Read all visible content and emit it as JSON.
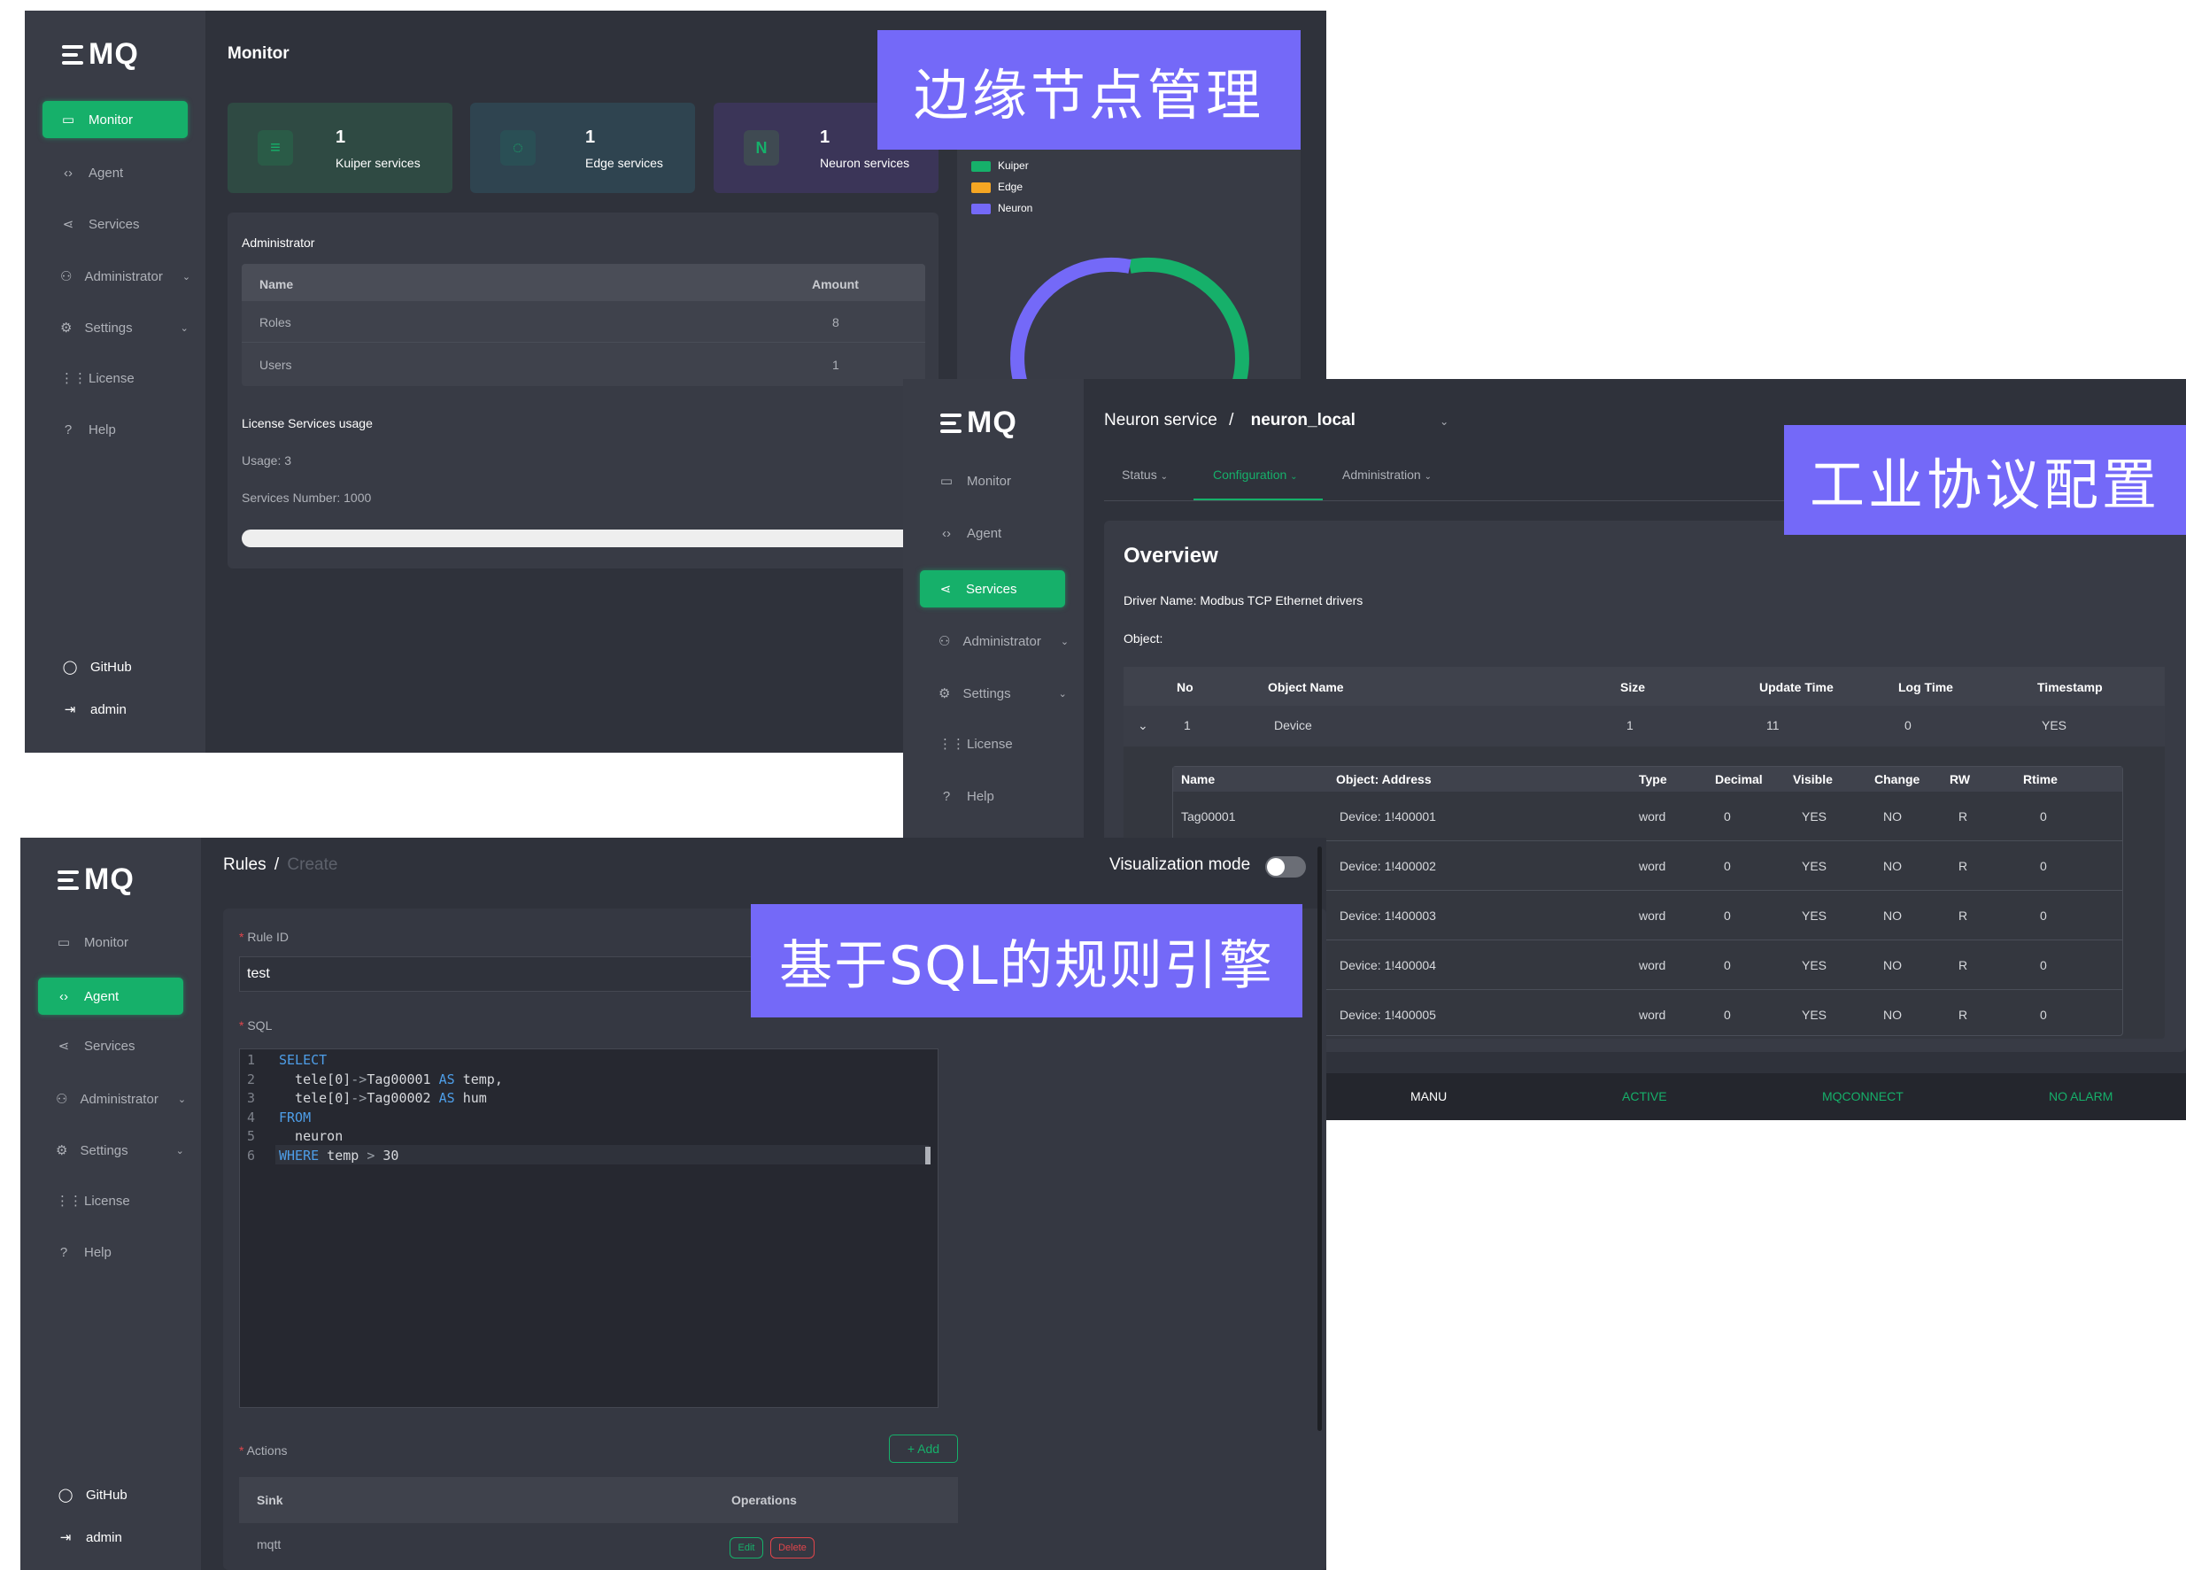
{
  "banners": {
    "edge": "边缘节点管理",
    "protocol": "工业协议配置",
    "rules": "基于SQL的规则引擎"
  },
  "logo": "MQ",
  "nav": {
    "monitor": "Monitor",
    "agent": "Agent",
    "services": "Services",
    "administrator": "Administrator",
    "settings": "Settings",
    "license": "License",
    "help": "Help",
    "github": "GitHub",
    "admin": "admin"
  },
  "monitor": {
    "title": "Monitor",
    "stats": [
      {
        "value": "1",
        "label": "Kuiper services"
      },
      {
        "value": "1",
        "label": "Edge services"
      },
      {
        "value": "1",
        "label": "Neuron services"
      }
    ],
    "admin_title": "Administrator",
    "admin_table": {
      "headers": [
        "Name",
        "Amount"
      ],
      "rows": [
        [
          "Roles",
          "8"
        ],
        [
          "Users",
          "1"
        ]
      ]
    },
    "license_title": "License Services usage",
    "usage": "Usage: 3",
    "services_number": "Services Number: 1000",
    "legend": [
      "Kuiper",
      "Edge",
      "Neuron"
    ],
    "colors": {
      "kuiper": "#16b06a",
      "edge": "#f5a623",
      "neuron": "#7469f8"
    }
  },
  "neuron": {
    "breadcrumb_parent": "Neuron service",
    "breadcrumb_sep": "/",
    "breadcrumb_current": "neuron_local",
    "tabs": [
      "Status",
      "Configuration",
      "Administration"
    ],
    "overview": "Overview",
    "driver": "Driver Name: Modbus TCP Ethernet drivers",
    "object": "Object:",
    "obj_headers": [
      "No",
      "Object Name",
      "Size",
      "Update Time",
      "Log Time",
      "Timestamp"
    ],
    "obj_row": [
      "1",
      "Device",
      "1",
      "11",
      "0",
      "YES"
    ],
    "tag_headers": [
      "Name",
      "Object: Address",
      "Type",
      "Decimal",
      "Visible",
      "Change",
      "RW",
      "Rtime"
    ],
    "tag_rows": [
      [
        "Tag00001",
        "Device: 1!400001",
        "word",
        "0",
        "YES",
        "NO",
        "R",
        "0"
      ],
      [
        "",
        "Device: 1!400002",
        "word",
        "0",
        "YES",
        "NO",
        "R",
        "0"
      ],
      [
        "",
        "Device: 1!400003",
        "word",
        "0",
        "YES",
        "NO",
        "R",
        "0"
      ],
      [
        "",
        "Device: 1!400004",
        "word",
        "0",
        "YES",
        "NO",
        "R",
        "0"
      ],
      [
        "",
        "Device: 1!400005",
        "word",
        "0",
        "YES",
        "NO",
        "R",
        "0"
      ]
    ],
    "status_bar": [
      "MANU",
      "ACTIVE",
      "MQCONNECT",
      "NO ALARM"
    ]
  },
  "rules": {
    "breadcrumb_parent": "Rules",
    "breadcrumb_sep": "/",
    "breadcrumb_current": "Create",
    "visualization": "Visualization mode",
    "rule_id_label": "Rule ID",
    "rule_id_value": "test",
    "sql_label": "SQL",
    "sql_lines": [
      {
        "no": "1",
        "parts": [
          [
            "kw",
            "SELECT"
          ]
        ]
      },
      {
        "no": "2",
        "parts": [
          [
            "id",
            "  tele[0]"
          ],
          [
            "op",
            "->"
          ],
          [
            "id",
            "Tag00001 "
          ],
          [
            "kw",
            "AS"
          ],
          [
            "id",
            " temp,"
          ]
        ]
      },
      {
        "no": "3",
        "parts": [
          [
            "id",
            "  tele[0]"
          ],
          [
            "op",
            "->"
          ],
          [
            "id",
            "Tag00002 "
          ],
          [
            "kw",
            "AS"
          ],
          [
            "id",
            " hum"
          ]
        ]
      },
      {
        "no": "4",
        "parts": [
          [
            "kw",
            "FROM"
          ]
        ]
      },
      {
        "no": "5",
        "parts": [
          [
            "id",
            "  neuron"
          ]
        ]
      },
      {
        "no": "6",
        "parts": [
          [
            "kw",
            "WHERE"
          ],
          [
            "id",
            " temp "
          ],
          [
            "op",
            ">"
          ],
          [
            "id",
            " 30"
          ]
        ]
      }
    ],
    "actions_label": "Actions",
    "add_button": "+ Add",
    "actions_headers": [
      "Sink",
      "Operations"
    ],
    "actions_rows": [
      {
        "sink": "mqtt",
        "edit": "Edit",
        "delete": "Delete"
      }
    ],
    "required_mark": "*"
  }
}
